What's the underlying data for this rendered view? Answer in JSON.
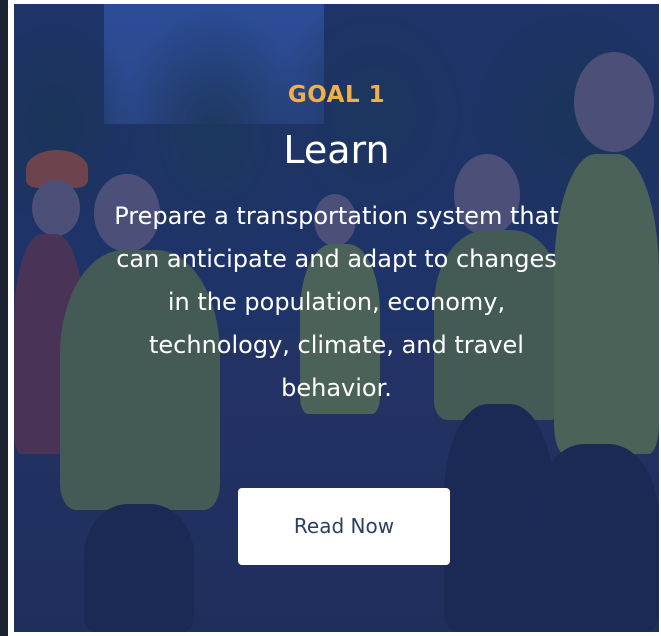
{
  "card": {
    "eyebrow": "GOAL 1",
    "title": "Learn",
    "description": "Prepare a transportation system that can anticipate and adapt to changes in the population, economy, technology, climate, and travel behavior.",
    "cta_label": "Read Now"
  },
  "colors": {
    "eyebrow": "#efb04a",
    "title": "#ffffff",
    "overlay": "#1c3a7a",
    "button_bg": "#ffffff",
    "button_text": "#2c3e63"
  }
}
